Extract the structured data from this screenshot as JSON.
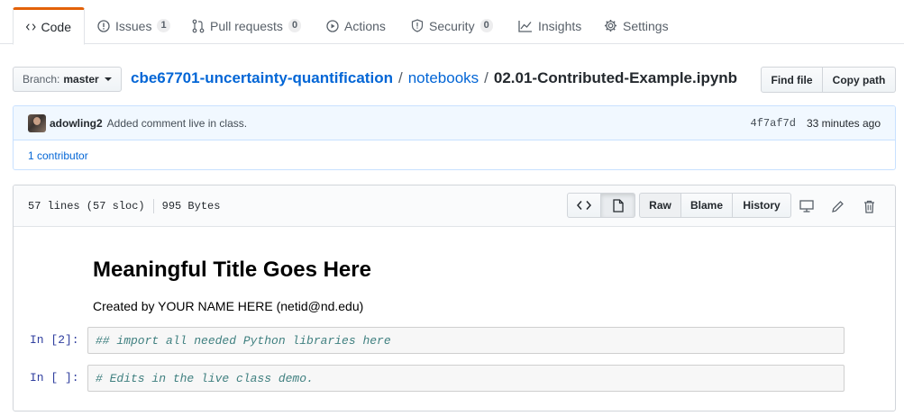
{
  "tabs": [
    {
      "label": "Code",
      "icon": "code-icon",
      "selected": true
    },
    {
      "label": "Issues",
      "icon": "issue-opened-icon",
      "count": "1"
    },
    {
      "label": "Pull requests",
      "icon": "git-pull-request-icon",
      "count": "0"
    },
    {
      "label": "Actions",
      "icon": "play-icon"
    },
    {
      "label": "Security",
      "icon": "shield-icon",
      "count": "0"
    },
    {
      "label": "Insights",
      "icon": "graph-icon"
    },
    {
      "label": "Settings",
      "icon": "gear-icon"
    }
  ],
  "branch": {
    "prefix": "Branch:",
    "name": "master"
  },
  "breadcrumb": {
    "repo": "cbe67701-uncertainty-quantification",
    "sep1": "/",
    "folder": "notebooks",
    "sep2": "/",
    "file": "02.01-Contributed-Example.ipynb"
  },
  "file_actions": {
    "find_file": "Find file",
    "copy_path": "Copy path"
  },
  "commit": {
    "author": "adowling2",
    "message": "Added comment live in class.",
    "sha": "4f7af7d",
    "time": "33 minutes ago",
    "contributors": "1 contributor"
  },
  "file": {
    "lines": "57 lines (57 sloc)",
    "size": "995 Bytes",
    "raw": "Raw",
    "blame": "Blame",
    "history": "History"
  },
  "notebook": {
    "title": "Meaningful Title Goes Here",
    "subtitle": "Created by YOUR NAME HERE (netid@nd.edu)",
    "cells": [
      {
        "prompt": "In [2]:",
        "code": "## import all needed Python libraries here"
      },
      {
        "prompt": "In [ ]:",
        "code": "# Edits in the live class demo."
      }
    ]
  },
  "colors": {
    "accent_tab": "#e36209",
    "link": "#0366d6",
    "prompt": "#303f9f",
    "comment": "#408080"
  }
}
